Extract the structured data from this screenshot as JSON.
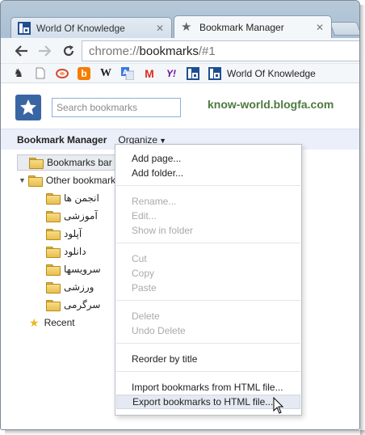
{
  "tabs": [
    {
      "title": "World Of Knowledge",
      "active": false
    },
    {
      "title": "Bookmark Manager",
      "active": true
    }
  ],
  "omnibox": {
    "scheme": "chrome://",
    "host": "bookmarks",
    "path": "/#1"
  },
  "bookmarks_bar": {
    "icons": [
      "running-man-icon",
      "blank-page-icon",
      "swirl-icon",
      "blogger-icon",
      "wikipedia-icon",
      "translate-icon",
      "gmail-icon",
      "yahoo-icon",
      "blogfa-icon",
      "blogfa-icon"
    ],
    "wikipedia_glyph": "W",
    "gmail_glyph": "M",
    "yahoo_glyph": "Y!",
    "label": "World Of Knowledge"
  },
  "manager": {
    "search_placeholder": "Search bookmarks",
    "brand": "know-world.blogfa.com",
    "title": "Bookmark Manager",
    "organize": "Organize"
  },
  "tree": {
    "bookmarks_bar": "Bookmarks bar",
    "other": "Other bookmarks",
    "children": [
      "انجمن ها",
      "آموزشی",
      "آپلود",
      "دانلود",
      "سرویسها",
      "ورزشی",
      "سرگرمی"
    ],
    "recent": "Recent"
  },
  "menu": {
    "add_page": "Add page...",
    "add_folder": "Add folder...",
    "rename": "Rename...",
    "edit": "Edit...",
    "show_in_folder": "Show in folder",
    "cut": "Cut",
    "copy": "Copy",
    "paste": "Paste",
    "delete": "Delete",
    "undo_delete": "Undo Delete",
    "reorder": "Reorder by title",
    "import": "Import bookmarks from HTML file...",
    "export": "Export bookmarks to HTML file..."
  },
  "colors": {
    "brand": "#4e7a3e",
    "accent": "#3a65a3",
    "menu_highlight": "#e4e9f2",
    "disabled": "#aaaaaa"
  }
}
